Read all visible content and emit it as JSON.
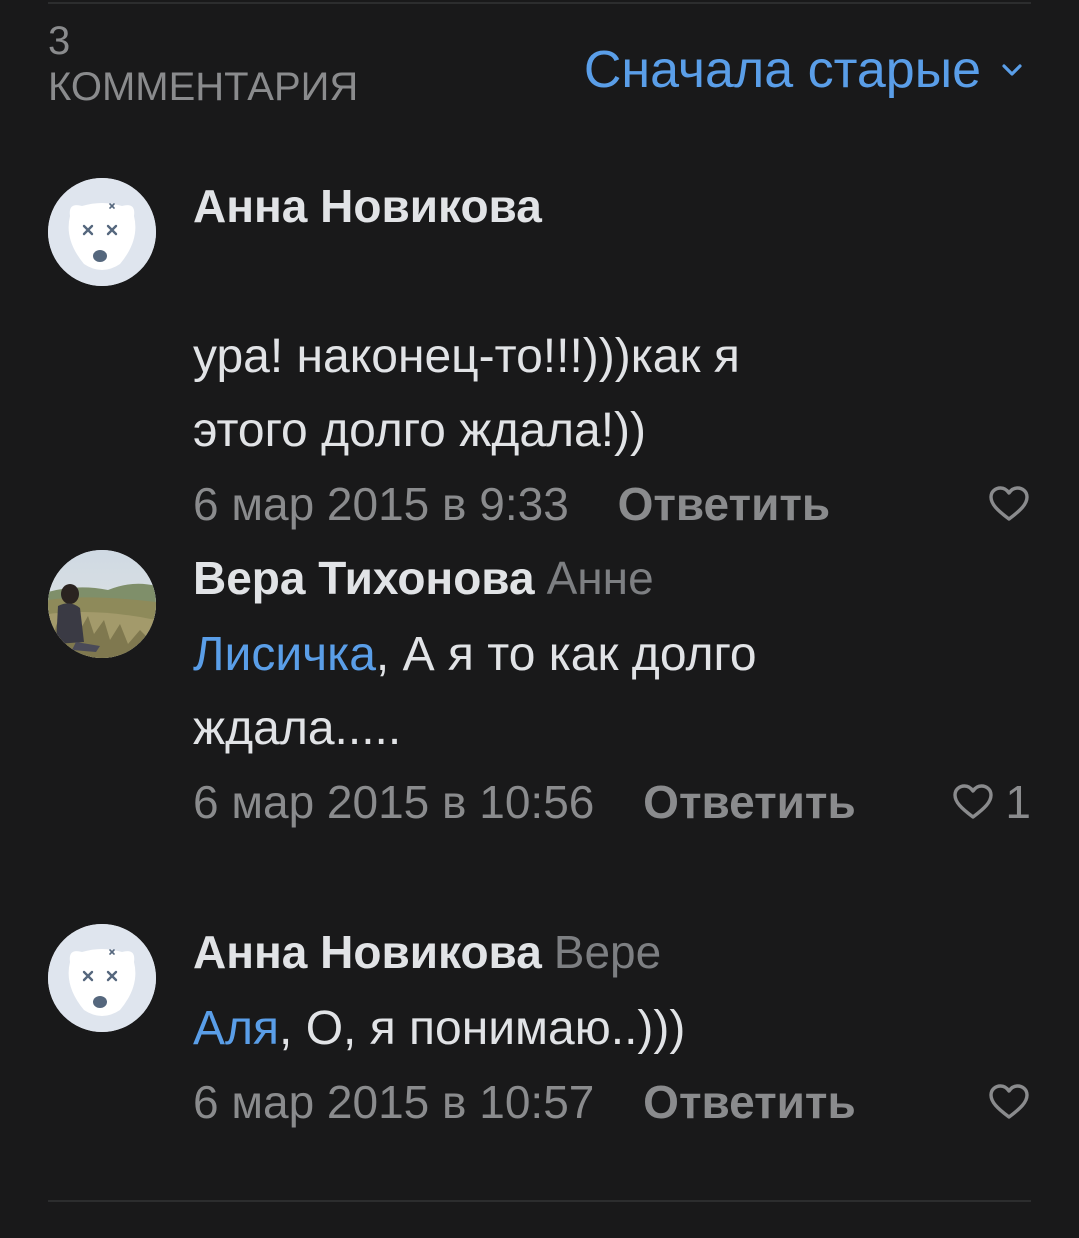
{
  "header": {
    "count": "3",
    "count_label": "КОММЕНТАРИЯ",
    "sort_label": "Сначала старые"
  },
  "colors": {
    "accent": "#5a9ee8",
    "background": "#19191a",
    "secondary_text": "#8a8b8d"
  },
  "comments": [
    {
      "author": "Анна Новикова",
      "reply_to": "",
      "mention": "",
      "text": "ура! наконец-то!!!)))как я\nэтого долго ждала!))",
      "date": "6 мар 2015 в 9:33",
      "reply_label": "Ответить",
      "likes": "",
      "avatar": "deactivated-dog-avatar"
    },
    {
      "author": "Вера Тихонова",
      "reply_to": "Анне",
      "mention": "Лисичка",
      "text": ", А я то как долго\nждала.....",
      "date": "6 мар 2015 в 10:56",
      "reply_label": "Ответить",
      "likes": "1",
      "avatar": "photo-avatar"
    },
    {
      "author": "Анна Новикова",
      "reply_to": "Вере",
      "mention": "Аля",
      "text": ", О, я понимаю..)))",
      "date": "6 мар 2015 в 10:57",
      "reply_label": "Ответить",
      "likes": "",
      "avatar": "deactivated-dog-avatar"
    }
  ]
}
